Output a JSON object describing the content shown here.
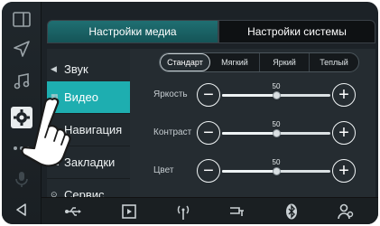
{
  "tabs": {
    "media": "Настройки медиа",
    "system": "Настройки системы"
  },
  "menu": [
    {
      "icon": "speaker-icon",
      "glyph": "◀",
      "label": "Звук"
    },
    {
      "icon": "video-icon",
      "glyph": "▦",
      "label": "Видео",
      "active": true
    },
    {
      "icon": "navigation-icon",
      "glyph": "",
      "label": "Навигация"
    },
    {
      "icon": "bookmark-icon",
      "glyph": "▬",
      "label": "Закладки"
    },
    {
      "icon": "service-icon",
      "glyph": "⊙",
      "label": "Сервис"
    }
  ],
  "presets": [
    "Стандарт",
    "Мягкий",
    "Яркий",
    "Теплый"
  ],
  "active_preset": "Стандарт",
  "sliders": [
    {
      "label": "Яркость",
      "value": 50,
      "fraction": 0.5
    },
    {
      "label": "Контраст",
      "value": 50,
      "fraction": 0.5
    },
    {
      "label": "Цвет",
      "value": 50,
      "fraction": 0.5
    }
  ],
  "buttons": {
    "minus": "−",
    "plus": "+"
  },
  "rail_icons": [
    "split-screen-icon",
    "navigation-arrow-icon",
    "music-icon",
    "settings-icon",
    "more-icon",
    "microphone-icon",
    "back-icon"
  ],
  "bottom_icons": [
    "usb-icon",
    "video-file-icon",
    "radio-icon",
    "aux-icon",
    "bluetooth-icon",
    "contacts-icon"
  ],
  "colors": {
    "accent": "#1eaeb0",
    "tab_active": "#1f6f72"
  }
}
